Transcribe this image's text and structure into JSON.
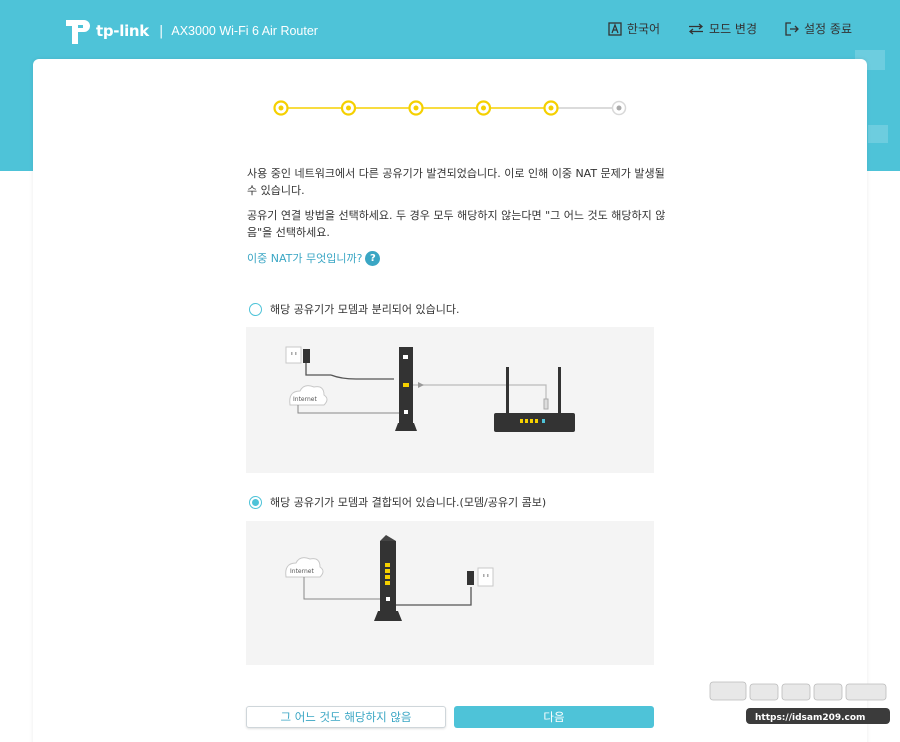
{
  "header": {
    "brand": "tp-link",
    "model": "AX3000 Wi-Fi 6 Air Router",
    "nav": [
      {
        "label": "한국어",
        "icon": "language-icon"
      },
      {
        "label": "모드 변경",
        "icon": "swap-arrows-icon"
      },
      {
        "label": "설정 종료",
        "icon": "exit-icon"
      }
    ]
  },
  "stepper": {
    "total_steps": 6,
    "completed_steps": 5
  },
  "content": {
    "para1": "사용 중인 네트워크에서 다른 공유기가 발견되었습니다. 이로 인해 이중 NAT 문제가 발생될 수 있습니다.",
    "para2": "공유기 연결 방법을 선택하세요. 두 경우 모두 해당하지 않는다면 \"그 어느 것도 해당하지 않음\"을 선택하세요.",
    "faq_link": "이중 NAT가 무엇입니까?",
    "faq_icon": "?"
  },
  "options": [
    {
      "label": "해당 공유기가 모뎀과 분리되어 있습니다.",
      "selected": false
    },
    {
      "label": "해당 공유기가 모뎀과 결합되어 있습니다.(모뎀/공유기 콤보)",
      "selected": true
    }
  ],
  "diagrams": {
    "internet_label": "Internet"
  },
  "buttons": {
    "skip": "그 어느 것도 해당하지 않음",
    "next": "다음"
  },
  "watermark": {
    "text": "https://idsam209.com"
  },
  "colors": {
    "accent": "#4ec3d8",
    "step_active": "#f5d000",
    "link": "#3aa6c4"
  }
}
